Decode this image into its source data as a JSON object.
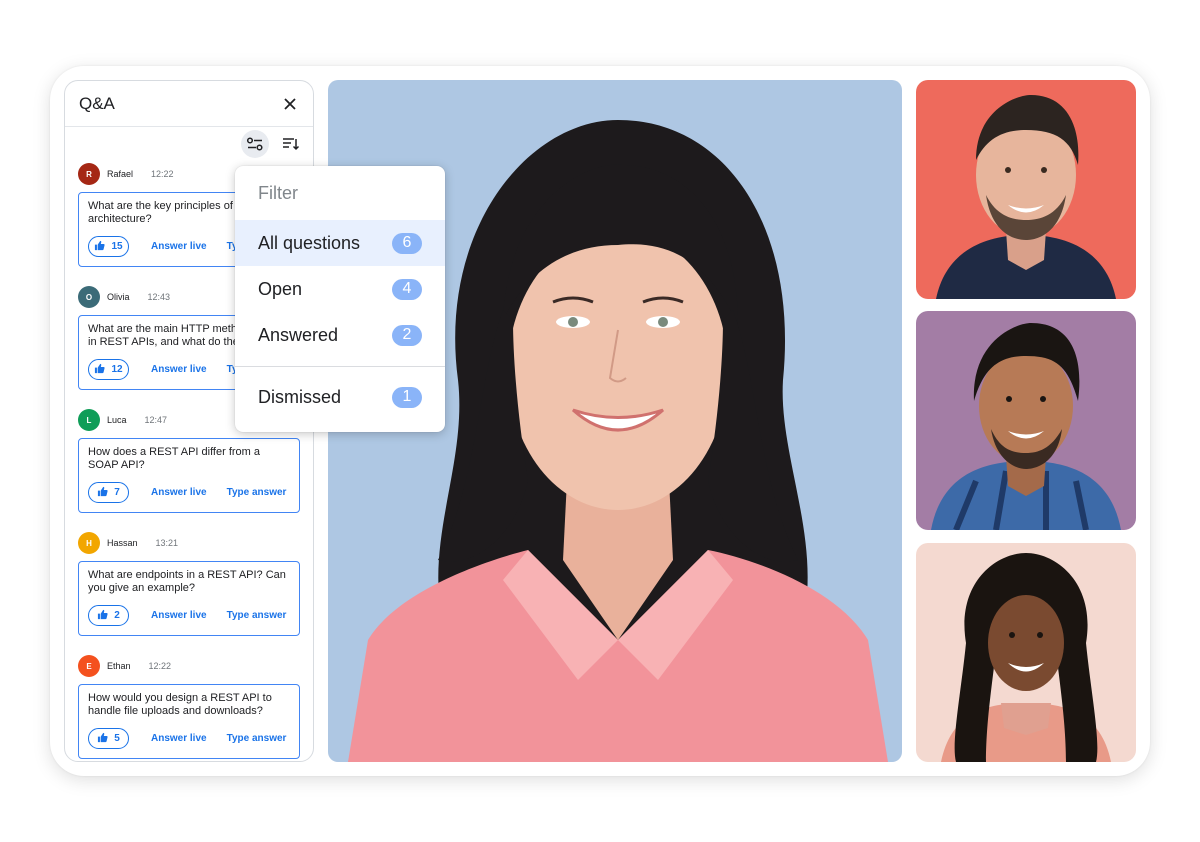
{
  "qa_panel": {
    "title": "Q&A",
    "close_icon": "close-icon",
    "filter_icon": "filter-sliders-icon",
    "sort_icon": "sort-icon",
    "questions": [
      {
        "initial": "R",
        "name": "Rafael",
        "time": "12:22",
        "avatar_color": "#a52714",
        "text": "What are the key principles of\narchitecture?",
        "likes": "15",
        "answer_live": "Answer live",
        "type_answer": "Ty"
      },
      {
        "initial": "O",
        "name": "Olivia",
        "time": "12:43",
        "avatar_color": "#3b6b78",
        "text": "What are the main HTTP meth\nin REST APIs, and what do the",
        "likes": "12",
        "answer_live": "Answer live",
        "type_answer": "Ty"
      },
      {
        "initial": "L",
        "name": "Luca",
        "time": "12:47",
        "avatar_color": "#0f9d58",
        "text": "How does a REST API differ from a\nSOAP API?",
        "likes": "7",
        "answer_live": "Answer live",
        "type_answer": "Type answer"
      },
      {
        "initial": "H",
        "name": "Hassan",
        "time": "13:21",
        "avatar_color": "#f2a600",
        "text": "What are endpoints in a REST API? Can\nyou give an example?",
        "likes": "2",
        "answer_live": "Answer live",
        "type_answer": "Type answer"
      },
      {
        "initial": "E",
        "name": "Ethan",
        "time": "12:22",
        "avatar_color": "#f4511e",
        "text": "How would you design a REST API to\nhandle file uploads and downloads?",
        "likes": "5",
        "answer_live": "Answer live",
        "type_answer": "Type answer"
      }
    ]
  },
  "filter_menu": {
    "title": "Filter",
    "options": [
      {
        "label": "All questions",
        "count": "6",
        "selected": true
      },
      {
        "label": "Open",
        "count": "4"
      },
      {
        "label": "Answered",
        "count": "2"
      }
    ],
    "dismissed": {
      "label": "Dismissed",
      "count": "1"
    }
  },
  "colors": {
    "accent": "#1a73e8",
    "badge": "#8ab4f8",
    "main_tile_bg": "#aec7e3",
    "tile_1_bg": "#ee6a5c",
    "tile_2_bg": "#a37da5",
    "tile_3_bg": "#f4d9d0"
  }
}
